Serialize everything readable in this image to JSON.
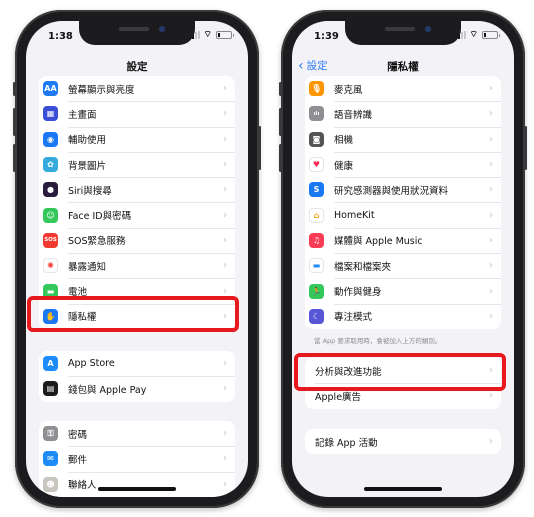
{
  "left_phone": {
    "status": {
      "time": "1:38"
    },
    "nav": {
      "title": "設定"
    },
    "groups": [
      {
        "items": [
          {
            "label": "螢幕顯示與亮度",
            "icon": "display-brightness-icon",
            "glyph": "AA",
            "color": "#1f7af7"
          },
          {
            "label": "主畫面",
            "icon": "home-screen-icon",
            "glyph": "▦",
            "color": "#3a4fd6"
          },
          {
            "label": "輔助使用",
            "icon": "accessibility-icon",
            "glyph": "◉",
            "color": "#1a78f2"
          },
          {
            "label": "背景圖片",
            "icon": "wallpaper-icon",
            "glyph": "✿",
            "color": "#35aadc"
          },
          {
            "label": "Siri與搜尋",
            "icon": "siri-icon",
            "glyph": "●",
            "color": "#2a1c3c"
          },
          {
            "label": "Face ID與密碼",
            "icon": "face-id-icon",
            "glyph": "☺",
            "color": "#34c759"
          },
          {
            "label": "SOS緊急服務",
            "icon": "sos-icon",
            "glyph": "SOS",
            "color": "#f23b30"
          },
          {
            "label": "暴露通知",
            "icon": "exposure-notification-icon",
            "glyph": "✺",
            "color": "#ffffff",
            "glyph_color": "#f23b30"
          },
          {
            "label": "電池",
            "icon": "battery-icon",
            "glyph": "▬",
            "color": "#34c759"
          },
          {
            "label": "隱私權",
            "icon": "privacy-hand-icon",
            "glyph": "✋",
            "color": "#1a78f2"
          }
        ]
      },
      {
        "items": [
          {
            "label": "App Store",
            "icon": "app-store-icon",
            "glyph": "A",
            "color": "#1d8cf8"
          },
          {
            "label": "錢包與 Apple Pay",
            "icon": "wallet-icon",
            "glyph": "▤",
            "color": "#1c1c1e"
          }
        ]
      },
      {
        "items": [
          {
            "label": "密碼",
            "icon": "key-icon",
            "glyph": "⚿",
            "color": "#8e8e93"
          },
          {
            "label": "郵件",
            "icon": "mail-icon",
            "glyph": "✉",
            "color": "#1d8cf8"
          },
          {
            "label": "聯絡人",
            "icon": "contacts-icon",
            "glyph": "☻",
            "color": "#c9c6c0"
          }
        ]
      }
    ]
  },
  "right_phone": {
    "status": {
      "time": "1:39"
    },
    "nav": {
      "title": "隱私權",
      "back_label": "設定"
    },
    "groups": [
      {
        "items": [
          {
            "label": "麥克風",
            "icon": "microphone-icon",
            "glyph": "🎙",
            "color": "#ff9500"
          },
          {
            "label": "語音辨識",
            "icon": "speech-recognition-icon",
            "glyph": "ılı",
            "color": "#8e8e93"
          },
          {
            "label": "相機",
            "icon": "camera-icon",
            "glyph": "◙",
            "color": "#545456"
          },
          {
            "label": "健康",
            "icon": "health-icon",
            "glyph": "♥",
            "color": "#ffffff",
            "glyph_color": "#ff2d55"
          },
          {
            "label": "研究感測器與使用狀況資料",
            "icon": "research-sensor-icon",
            "glyph": "S",
            "color": "#1a78f2"
          },
          {
            "label": "HomeKit",
            "icon": "homekit-icon",
            "glyph": "⌂",
            "color": "#ffffff",
            "glyph_color": "#ff9f0a"
          },
          {
            "label": "媒體與 Apple Music",
            "icon": "music-icon",
            "glyph": "♫",
            "color": "#fa3c55"
          },
          {
            "label": "檔案和檔案夾",
            "icon": "folder-icon",
            "glyph": "▬",
            "color": "#ffffff",
            "glyph_color": "#1d8cf8"
          },
          {
            "label": "動作與健身",
            "icon": "motion-fitness-icon",
            "glyph": "🏃",
            "color": "#34c759"
          },
          {
            "label": "專注模式",
            "icon": "focus-moon-icon",
            "glyph": "☾",
            "color": "#5856d6"
          }
        ]
      },
      {
        "items": [
          {
            "label": "分析與改進功能"
          },
          {
            "label": "Apple廣告"
          }
        ]
      },
      {
        "items": [
          {
            "label": "記錄 App 活動"
          }
        ]
      }
    ],
    "footnote": "當 App 要求取用時，會被加入上方的類別。"
  },
  "highlight_color": "#e8191c",
  "chevron": "›"
}
